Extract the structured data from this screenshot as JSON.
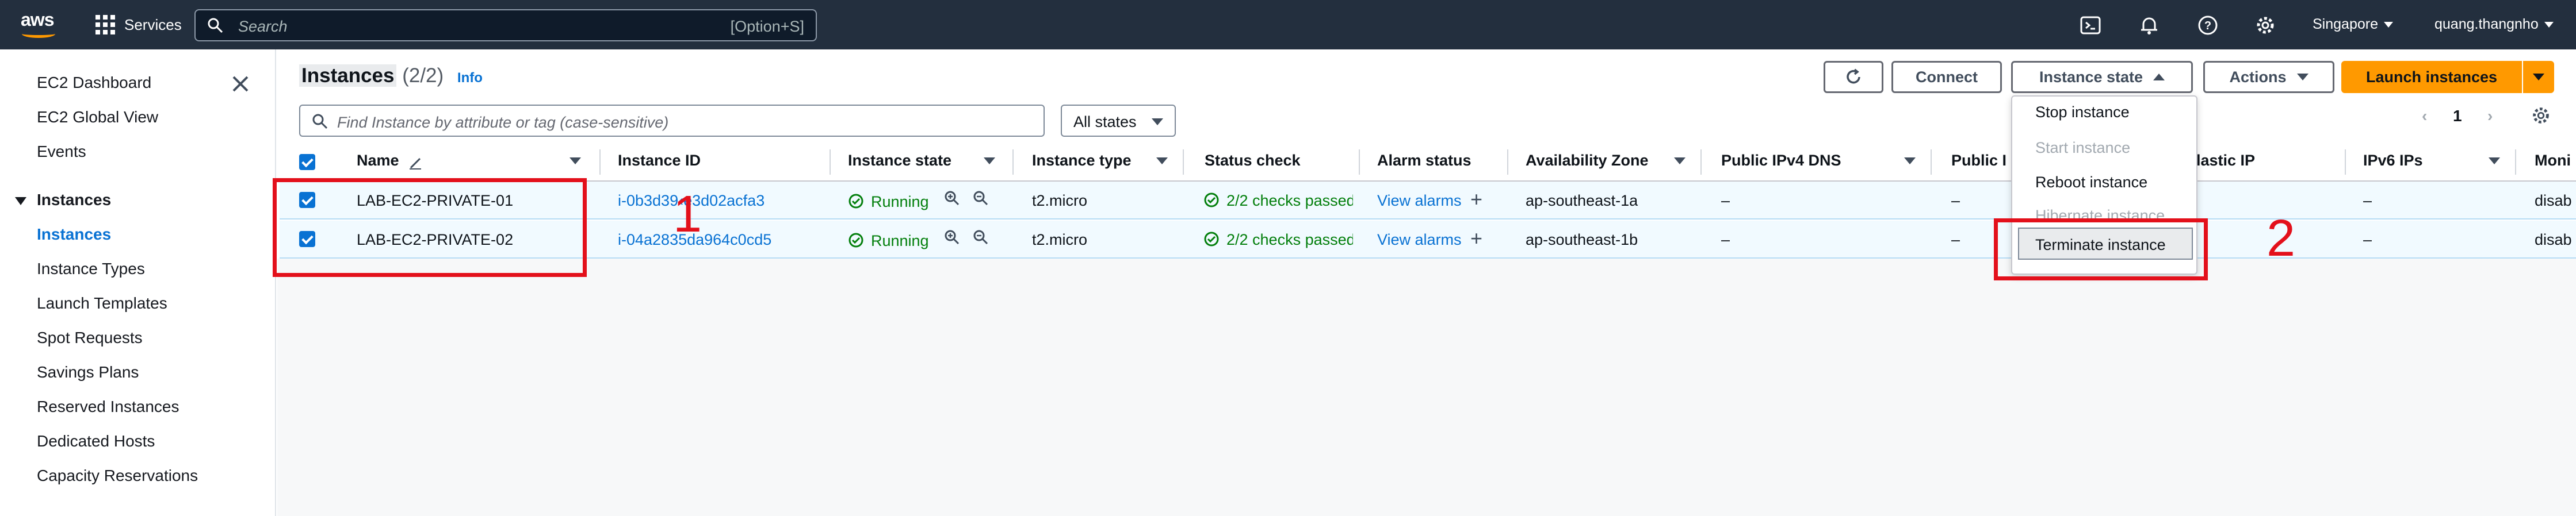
{
  "topnav": {
    "logo_text": "aws",
    "services_label": "Services",
    "search_placeholder": "Search",
    "search_shortcut": "[Option+S]",
    "region": "Singapore",
    "user": "quang.thangnho"
  },
  "sidebar": {
    "items": [
      "EC2 Dashboard",
      "EC2 Global View",
      "Events"
    ],
    "section": "Instances",
    "sub_items": [
      "Instances",
      "Instance Types",
      "Launch Templates",
      "Spot Requests",
      "Savings Plans",
      "Reserved Instances",
      "Dedicated Hosts",
      "Capacity Reservations"
    ]
  },
  "header": {
    "title": "Instances",
    "count": "(2/2)",
    "info": "Info",
    "connect": "Connect",
    "instance_state": "Instance state",
    "actions": "Actions",
    "launch": "Launch instances"
  },
  "filter": {
    "placeholder": "Find Instance by attribute or tag (case-sensitive)",
    "states": "All states",
    "page": "1"
  },
  "columns": [
    "Name",
    "Instance ID",
    "Instance state",
    "Instance type",
    "Status check",
    "Alarm status",
    "Availability Zone",
    "Public IPv4 DNS",
    "Public I",
    "Elastic IP",
    "IPv6 IPs",
    "Moni"
  ],
  "rows": [
    {
      "name": "LAB-EC2-PRIVATE-01",
      "id": "i-0b3d39‹e3d02acfa3",
      "state": "Running",
      "type": "t2.micro",
      "status": "2/2 checks passed",
      "alarm": "View alarms",
      "az": "ap-southeast-1a",
      "dns": "–",
      "pub": "–",
      "ipv6": "–",
      "mon": "disab"
    },
    {
      "name": "LAB-EC2-PRIVATE-02",
      "id": "i-04a2835da964c0cd5",
      "state": "Running",
      "type": "t2.micro",
      "status": "2/2 checks passed",
      "alarm": "View alarms",
      "az": "ap-southeast-1b",
      "dns": "–",
      "pub": "–",
      "ipv6": "–",
      "mon": "disab"
    }
  ],
  "menu": {
    "stop": "Stop instance",
    "start": "Start instance",
    "reboot": "Reboot instance",
    "hibernate": "Hibernate instance",
    "terminate": "Terminate instance"
  },
  "annotations": {
    "step1": "1",
    "step2": "2"
  },
  "colors": {
    "nav_bg": "#232f3e",
    "accent": "#ff9900",
    "link": "#0972d3",
    "success": "#037f0c",
    "annotation": "#e3101b"
  }
}
